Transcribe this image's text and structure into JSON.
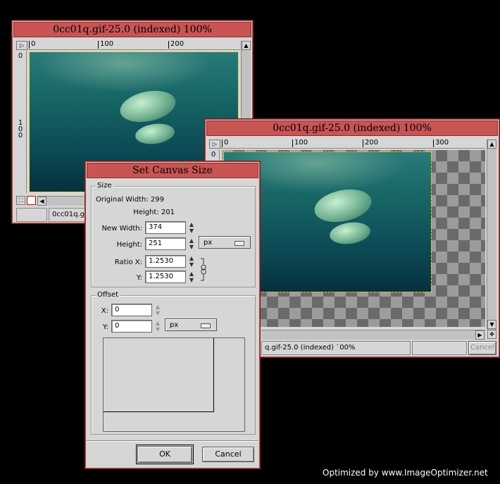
{
  "window_back": {
    "title": "0cc01q.gif-25.0 (indexed) 100%",
    "ruler_labels": [
      "0",
      "100",
      "200"
    ],
    "vruler_labels": [
      "0",
      "1",
      "0",
      "0"
    ],
    "status_text": "0cc01q.gif-"
  },
  "window_front": {
    "title": "0cc01q.gif-25.0 (indexed) 100%",
    "ruler_labels": [
      "0",
      "100",
      "200",
      "300"
    ],
    "vruler_labels": [
      "0"
    ],
    "status_text": "q.gif-25.0 (indexed) `00%",
    "cancel_label": "Cancel"
  },
  "dialog": {
    "title": "Set Canvas Size",
    "size_group": "Size",
    "original_width_label": "Original Width: 299",
    "original_height_label": "Height: 201",
    "new_width_label": "New Width:",
    "new_width_value": "374",
    "height_label": "Height:",
    "height_value": "251",
    "unit_value": "px",
    "ratio_x_label": "Ratio X:",
    "ratio_x_value": "1.2530",
    "ratio_y_label": "Y:",
    "ratio_y_value": "1.2530",
    "offset_group": "Offset",
    "offset_x_label": "X:",
    "offset_x_value": "0",
    "offset_y_label": "Y:",
    "offset_y_value": "0",
    "offset_unit_value": "px",
    "ok_label": "OK",
    "cancel_label": "Cancel"
  },
  "watermark": "Optimized by www.ImageOptimizer.net"
}
